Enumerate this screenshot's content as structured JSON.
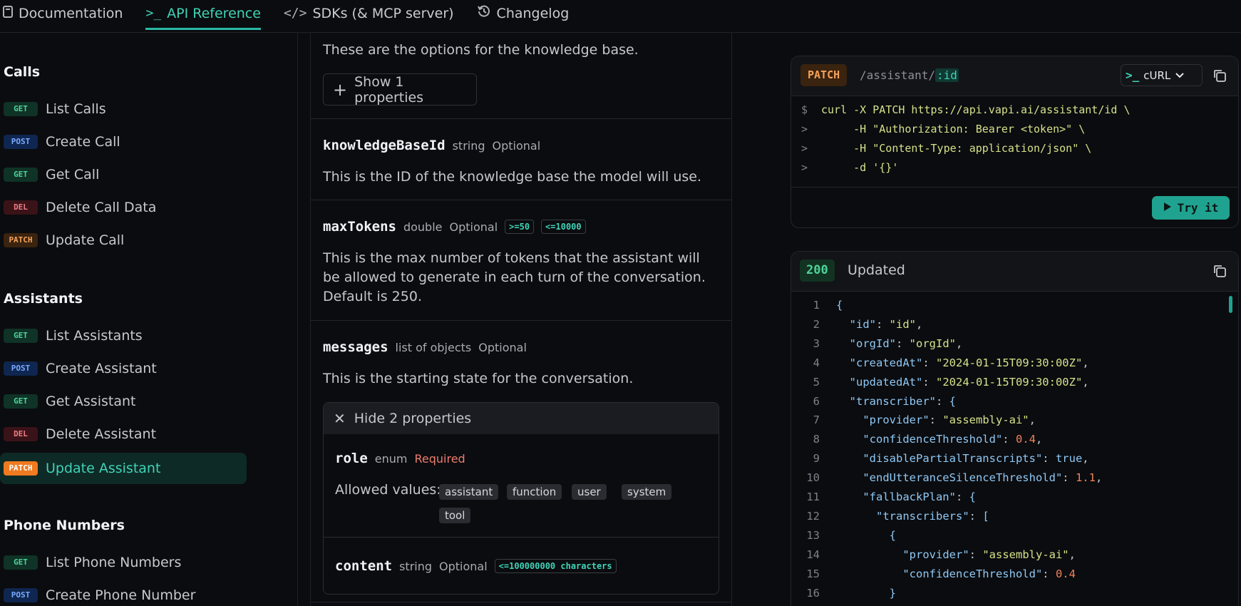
{
  "topnav": {
    "tabs": [
      {
        "label": "Documentation",
        "icon": "book-icon"
      },
      {
        "label": "API Reference",
        "icon": "terminal-icon"
      },
      {
        "label": "SDKs (& MCP server)",
        "icon": "code-icon"
      },
      {
        "label": "Changelog",
        "icon": "history-icon"
      }
    ]
  },
  "sidebar": {
    "sections": [
      {
        "title": "Calls"
      },
      {
        "title": "Assistants"
      },
      {
        "title": "Phone Numbers"
      }
    ],
    "items": [
      {
        "method": "GET",
        "label": "List Calls"
      },
      {
        "method": "POST",
        "label": "Create Call"
      },
      {
        "method": "GET",
        "label": "Get Call"
      },
      {
        "method": "DEL",
        "label": "Delete Call Data"
      },
      {
        "method": "PATCH",
        "label": "Update Call"
      },
      {
        "method": "GET",
        "label": "List Assistants"
      },
      {
        "method": "POST",
        "label": "Create Assistant"
      },
      {
        "method": "GET",
        "label": "Get Assistant"
      },
      {
        "method": "DEL",
        "label": "Delete Assistant"
      },
      {
        "method": "PATCH",
        "label": "Update Assistant"
      },
      {
        "method": "GET",
        "label": "List Phone Numbers"
      },
      {
        "method": "POST",
        "label": "Create Phone Number"
      }
    ]
  },
  "params": {
    "kb_options_desc": "These are the options for the knowledge base.",
    "show_props_label": "Show 1 properties",
    "knowledgeBaseId": {
      "name": "knowledgeBaseId",
      "type": "string",
      "optional": "Optional",
      "desc": "This is the ID of the knowledge base the model will use."
    },
    "maxTokens": {
      "name": "maxTokens",
      "type": "double",
      "optional": "Optional",
      "min": ">=50",
      "max": "<=10000",
      "desc": "This is the max number of tokens that the assistant will be allowed to generate in each turn of the conversation. Default is 250."
    },
    "messages": {
      "name": "messages",
      "type": "list of objects",
      "optional": "Optional",
      "desc": "This is the starting state for the conversation.",
      "hide_props_label": "Hide 2 properties"
    },
    "role": {
      "name": "role",
      "type": "enum",
      "required": "Required",
      "allowed_label": "Allowed values:",
      "values": [
        "assistant",
        "function",
        "user",
        "system",
        "tool"
      ]
    },
    "content": {
      "name": "content",
      "type": "string",
      "optional": "Optional",
      "limit": "<=100000000 characters"
    }
  },
  "request": {
    "method": "PATCH",
    "path_prefix": "/assistant/",
    "path_var": ":id",
    "language": "cURL",
    "code": [
      {
        "prompt": "$",
        "text": "curl -X PATCH https://api.vapi.ai/assistant/id \\"
      },
      {
        "prompt": ">",
        "text": "     -H \"Authorization: Bearer <token>\" \\"
      },
      {
        "prompt": ">",
        "text": "     -H \"Content-Type: application/json\" \\"
      },
      {
        "prompt": ">",
        "text": "     -d '{}'"
      }
    ],
    "try_label": "Try it"
  },
  "response": {
    "status": "200",
    "status_label": "Updated",
    "lines": [
      {
        "n": "1",
        "indent": "",
        "key": "",
        "value": "",
        "tail": "{"
      },
      {
        "n": "2",
        "indent": "  ",
        "key": "\"id\"",
        "value": "\"id\"",
        "vtype": "s",
        "tail": ","
      },
      {
        "n": "3",
        "indent": "  ",
        "key": "\"orgId\"",
        "value": "\"orgId\"",
        "vtype": "s",
        "tail": ","
      },
      {
        "n": "4",
        "indent": "  ",
        "key": "\"createdAt\"",
        "value": "\"2024-01-15T09:30:00Z\"",
        "vtype": "s",
        "tail": ","
      },
      {
        "n": "5",
        "indent": "  ",
        "key": "\"updatedAt\"",
        "value": "\"2024-01-15T09:30:00Z\"",
        "vtype": "s",
        "tail": ","
      },
      {
        "n": "6",
        "indent": "  ",
        "key": "\"transcriber\"",
        "value": "",
        "tail": "{"
      },
      {
        "n": "7",
        "indent": "    ",
        "key": "\"provider\"",
        "value": "\"assembly-ai\"",
        "vtype": "s",
        "tail": ","
      },
      {
        "n": "8",
        "indent": "    ",
        "key": "\"confidenceThreshold\"",
        "value": "0.4",
        "vtype": "n",
        "tail": ","
      },
      {
        "n": "9",
        "indent": "    ",
        "key": "\"disablePartialTranscripts\"",
        "value": "true",
        "vtype": "k",
        "tail": ","
      },
      {
        "n": "10",
        "indent": "    ",
        "key": "\"endUtteranceSilenceThreshold\"",
        "value": "1.1",
        "vtype": "n",
        "tail": ","
      },
      {
        "n": "11",
        "indent": "    ",
        "key": "\"fallbackPlan\"",
        "value": "",
        "tail": "{"
      },
      {
        "n": "12",
        "indent": "      ",
        "key": "\"transcribers\"",
        "value": "",
        "tail": "["
      },
      {
        "n": "13",
        "indent": "        ",
        "key": "",
        "value": "",
        "tail": "{"
      },
      {
        "n": "14",
        "indent": "          ",
        "key": "\"provider\"",
        "value": "\"assembly-ai\"",
        "vtype": "s",
        "tail": ","
      },
      {
        "n": "15",
        "indent": "          ",
        "key": "\"confidenceThreshold\"",
        "value": "0.4",
        "vtype": "n",
        "tail": ""
      },
      {
        "n": "16",
        "indent": "        ",
        "key": "",
        "value": "",
        "tail": "}"
      }
    ]
  },
  "colors": {
    "accent": "#3fd3b7",
    "patch": "#f07a1f",
    "get": "#4fd39a",
    "post": "#7aa9ff",
    "del": "#f07b85"
  }
}
